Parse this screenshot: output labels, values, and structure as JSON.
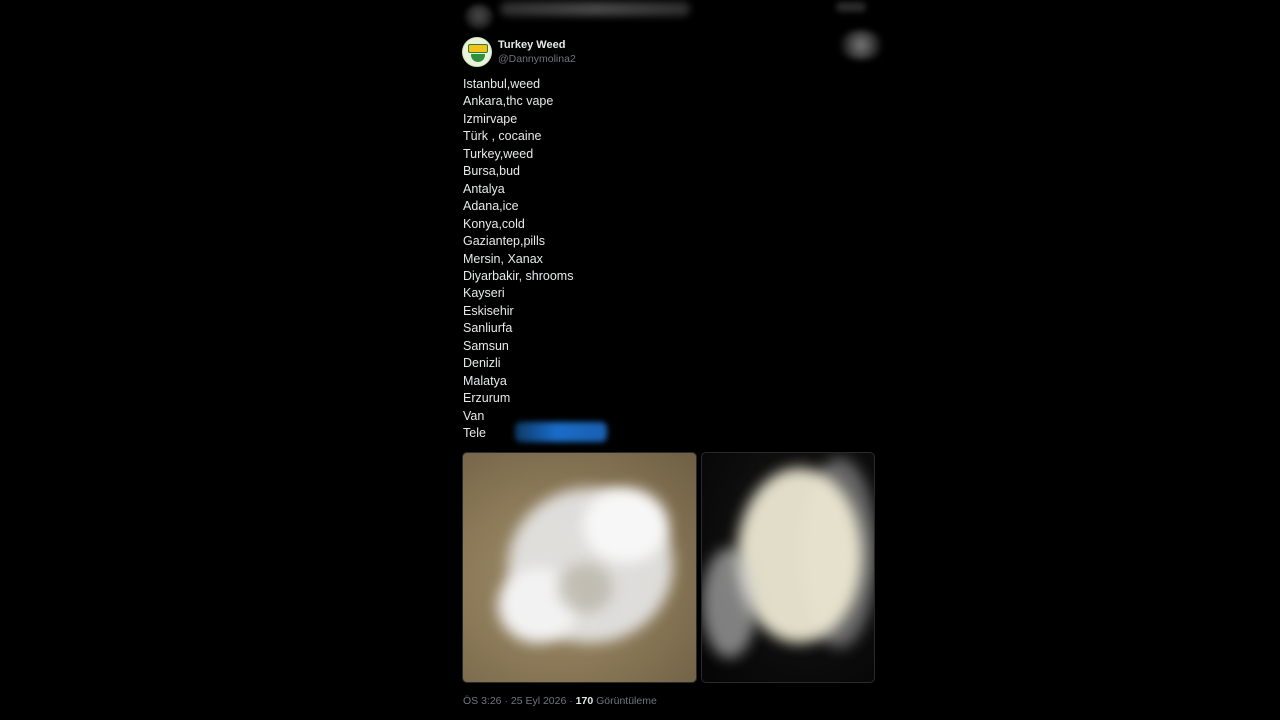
{
  "tweet": {
    "display_name": "Turkey Weed",
    "handle": "@Dannymolina2",
    "lines": [
      "Istanbul,weed",
      "Ankara,thc vape",
      "Izmirvape",
      "Türk , cocaine",
      "Turkey,weed",
      "Bursa,bud",
      "Antalya",
      "Adana,ice",
      "Konya,cold",
      "Gaziantep,pills",
      "Mersin, Xanax",
      "Diyarbakir, shrooms",
      "Kayseri",
      "Eskisehir",
      "Sanliurfa",
      "Samsun",
      "Denizli",
      "Malatya",
      "Erzurum",
      "Van",
      "Tele"
    ],
    "timestamp": "ÖS 3:26 · 25 Eyl 2026 · ",
    "views_count": "170",
    "views_label": " Görüntüleme"
  },
  "colors": {
    "background": "#000000",
    "text_primary": "#e7e9ea",
    "text_secondary": "#71767b",
    "link_blur": "#1a6cc9"
  }
}
